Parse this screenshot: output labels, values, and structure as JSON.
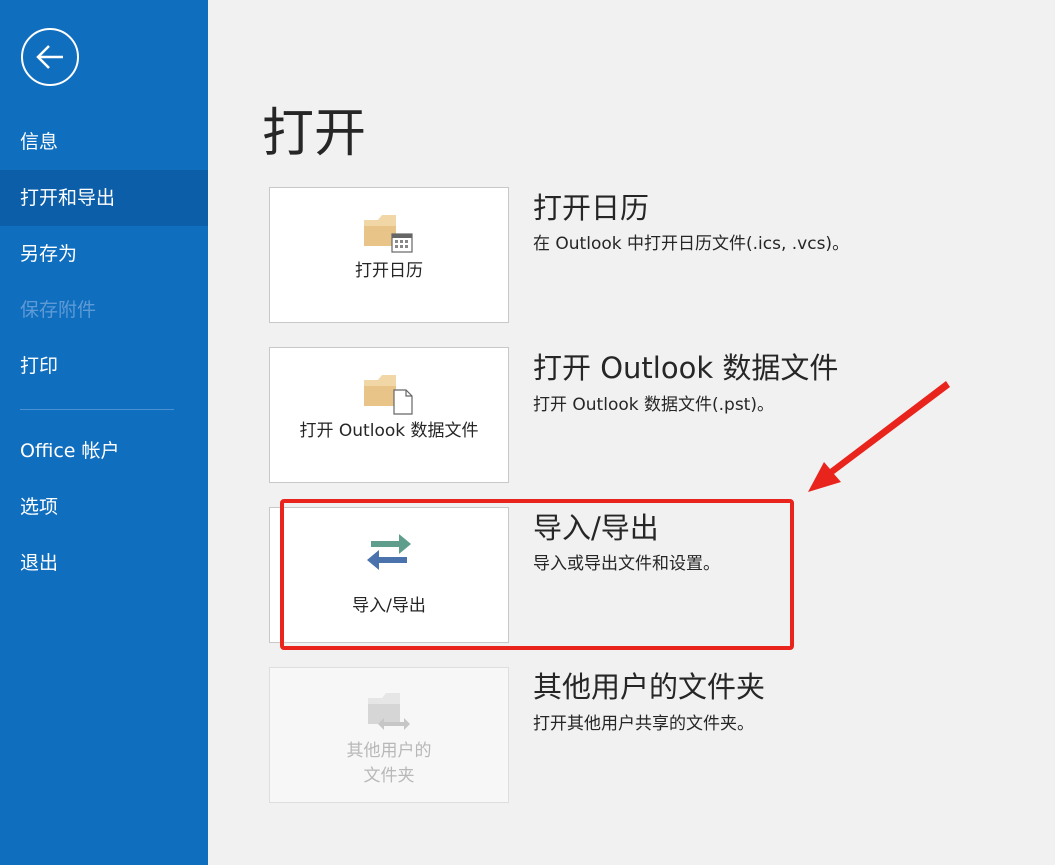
{
  "sidebar": {
    "items": [
      {
        "label": "信息",
        "state": "normal"
      },
      {
        "label": "打开和导出",
        "state": "active"
      },
      {
        "label": "另存为",
        "state": "normal"
      },
      {
        "label": "保存附件",
        "state": "disabled"
      },
      {
        "label": "打印",
        "state": "normal"
      },
      {
        "label": "Office 帐户",
        "state": "normal"
      },
      {
        "label": "选项",
        "state": "normal"
      },
      {
        "label": "退出",
        "state": "normal"
      }
    ]
  },
  "main": {
    "title": "打开",
    "options": [
      {
        "tile_label": "打开日历",
        "heading": "打开日历",
        "description": "在 Outlook 中打开日历文件(.ics, .vcs)。",
        "icon": "folder-calendar-icon"
      },
      {
        "tile_label": "打开 Outlook 数据文件",
        "heading": "打开 Outlook 数据文件",
        "description": "打开 Outlook 数据文件(.pst)。",
        "icon": "folder-file-icon"
      },
      {
        "tile_label": "导入/导出",
        "heading": "导入/导出",
        "description": "导入或导出文件和设置。",
        "icon": "import-export-arrows-icon"
      },
      {
        "tile_label_line1": "其他用户的",
        "tile_label_line2": "文件夹",
        "heading": "其他用户的文件夹",
        "description": "打开其他用户共享的文件夹。",
        "icon": "shared-folder-icon",
        "state": "disabled"
      }
    ]
  },
  "colors": {
    "sidebar_bg": "#106ebe",
    "sidebar_active": "#0c5ea8",
    "highlight": "#e8241c",
    "arrow_green": "#5f9e8c",
    "arrow_blue": "#4a72ad",
    "folder": "#e8c489"
  }
}
